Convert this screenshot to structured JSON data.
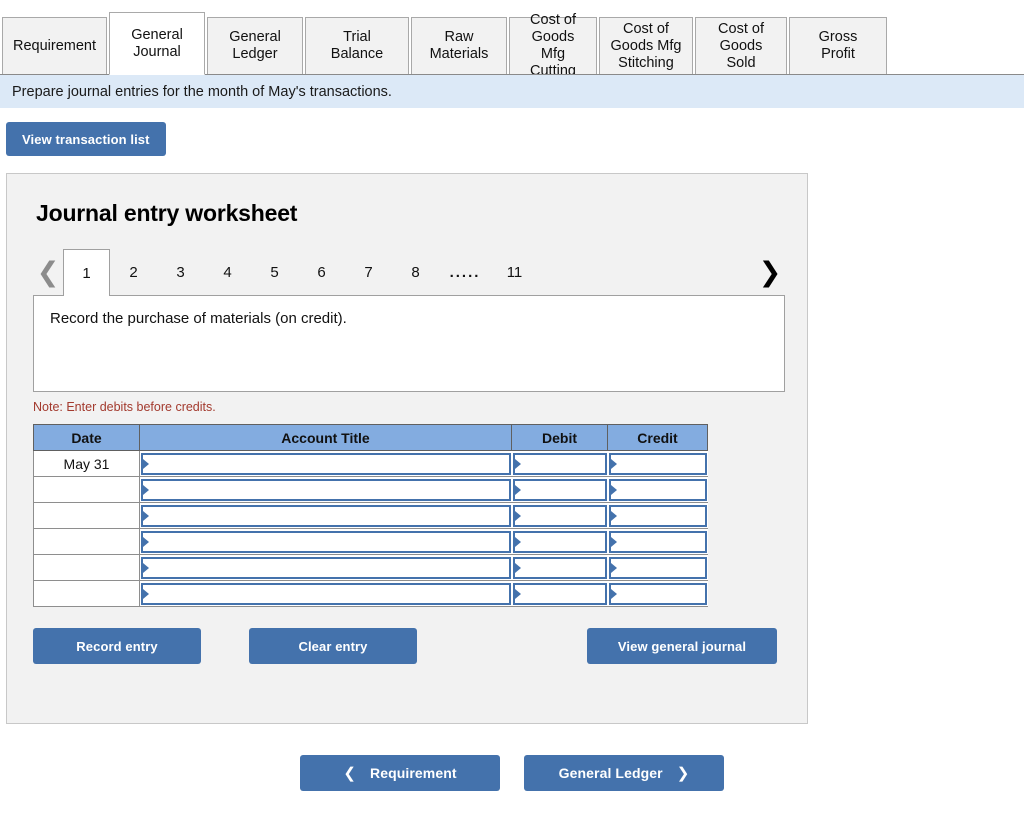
{
  "tabs": [
    {
      "label": "Requirement",
      "active": false,
      "width": 105
    },
    {
      "label": "General\nJournal",
      "active": true,
      "width": 96
    },
    {
      "label": "General\nLedger",
      "active": false,
      "width": 96
    },
    {
      "label": "Trial Balance",
      "active": false,
      "width": 104
    },
    {
      "label": "Raw\nMaterials",
      "active": false,
      "width": 96
    },
    {
      "label": "Cost of\nGoods Mfg\nCutting",
      "active": false,
      "width": 88
    },
    {
      "label": "Cost of\nGoods Mfg\nStitching",
      "active": false,
      "width": 94
    },
    {
      "label": "Cost of\nGoods Sold",
      "active": false,
      "width": 92
    },
    {
      "label": "Gross Profit",
      "active": false,
      "width": 98
    }
  ],
  "banner": {
    "text": "Prepare journal entries for the month of May's transactions."
  },
  "toolbar": {
    "view_transaction_list": "View transaction list"
  },
  "worksheet": {
    "title": "Journal entry worksheet",
    "prev_icon": "chevron-left-icon",
    "next_icon": "chevron-right-icon",
    "pages": [
      "1",
      "2",
      "3",
      "4",
      "5",
      "6",
      "7",
      "8",
      ".....",
      "11"
    ],
    "active_page": "1",
    "prompt": "Record the purchase of materials (on credit).",
    "note": "Note: Enter debits before credits.",
    "table": {
      "headers": [
        "Date",
        "Account Title",
        "Debit",
        "Credit"
      ],
      "rows": [
        {
          "date": "May 31",
          "account": "",
          "debit": "",
          "credit": ""
        },
        {
          "date": "",
          "account": "",
          "debit": "",
          "credit": ""
        },
        {
          "date": "",
          "account": "",
          "debit": "",
          "credit": ""
        },
        {
          "date": "",
          "account": "",
          "debit": "",
          "credit": ""
        },
        {
          "date": "",
          "account": "",
          "debit": "",
          "credit": ""
        },
        {
          "date": "",
          "account": "",
          "debit": "",
          "credit": ""
        }
      ]
    },
    "actions": {
      "record_entry": "Record entry",
      "clear_entry": "Clear entry",
      "view_general_journal": "View general journal"
    }
  },
  "footer": {
    "prev_chevron": "chevron-left-icon",
    "prev_label": "Requirement",
    "next_label": "General Ledger",
    "next_chevron": "chevron-right-icon"
  },
  "colors": {
    "accent_blue": "#4472ac",
    "table_header_blue": "#83ace0",
    "banner_blue": "#dce9f7",
    "panel_gray": "#f2f2f2",
    "note_red": "#a33a2e"
  }
}
